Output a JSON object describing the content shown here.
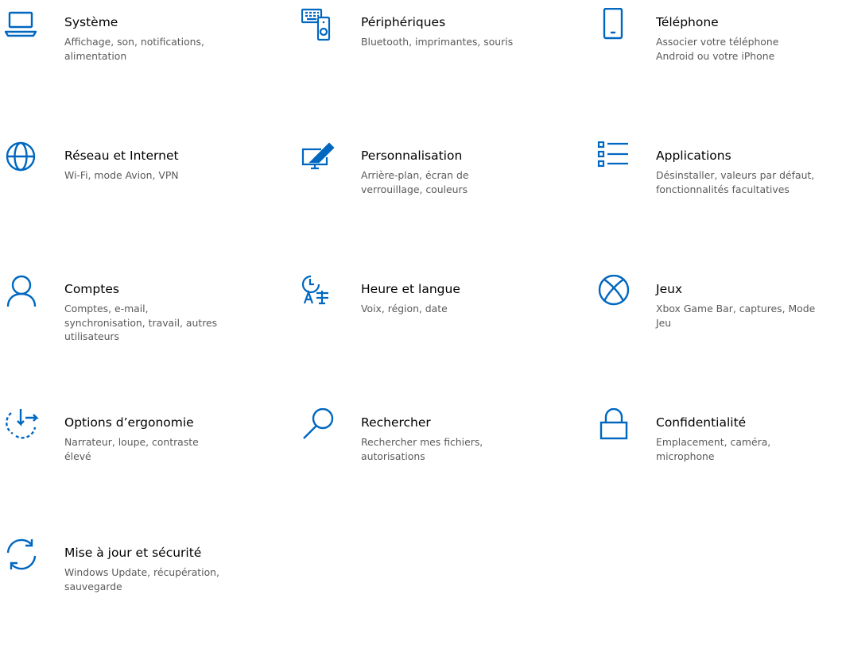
{
  "accent": "#0067c0",
  "tiles": [
    {
      "title": "Système",
      "desc": [
        "Affichage, son, notifications,",
        "alimentation"
      ],
      "icon": "laptop-icon"
    },
    {
      "title": "Périphériques",
      "desc": [
        "Bluetooth, imprimantes, souris"
      ],
      "icon": "devices-icon"
    },
    {
      "title": "Téléphone",
      "desc": [
        "Associer votre téléphone",
        "Android ou votre iPhone"
      ],
      "icon": "phone-icon"
    },
    {
      "title": "Réseau et Internet",
      "desc": [
        "Wi-Fi, mode Avion, VPN"
      ],
      "icon": "globe-icon"
    },
    {
      "title": "Personnalisation",
      "desc": [
        "Arrière-plan, écran de",
        "verrouillage, couleurs"
      ],
      "icon": "paint-icon"
    },
    {
      "title": "Applications",
      "desc": [
        "Désinstaller, valeurs par défaut,",
        "fonctionnalités facultatives"
      ],
      "icon": "apps-list-icon"
    },
    {
      "title": "Comptes",
      "desc": [
        "Comptes, e-mail,",
        "synchronisation, travail, autres",
        "utilisateurs"
      ],
      "icon": "person-icon"
    },
    {
      "title": "Heure et langue",
      "desc": [
        "Voix, région, date"
      ],
      "icon": "time-language-icon"
    },
    {
      "title": "Jeux",
      "desc": [
        "Xbox Game Bar, captures, Mode",
        "Jeu"
      ],
      "icon": "xbox-icon"
    },
    {
      "title": "Options d’ergonomie",
      "desc": [
        "Narrateur, loupe, contraste",
        "élevé"
      ],
      "icon": "ease-of-access-icon"
    },
    {
      "title": "Rechercher",
      "desc": [
        "Rechercher mes fichiers,",
        "autorisations"
      ],
      "icon": "search-icon"
    },
    {
      "title": "Confidentialité",
      "desc": [
        "Emplacement, caméra,",
        "microphone"
      ],
      "icon": "lock-icon"
    },
    {
      "title": "Mise à jour et sécurité",
      "desc": [
        "Windows Update, récupération,",
        "sauvegarde"
      ],
      "icon": "sync-icon"
    }
  ]
}
